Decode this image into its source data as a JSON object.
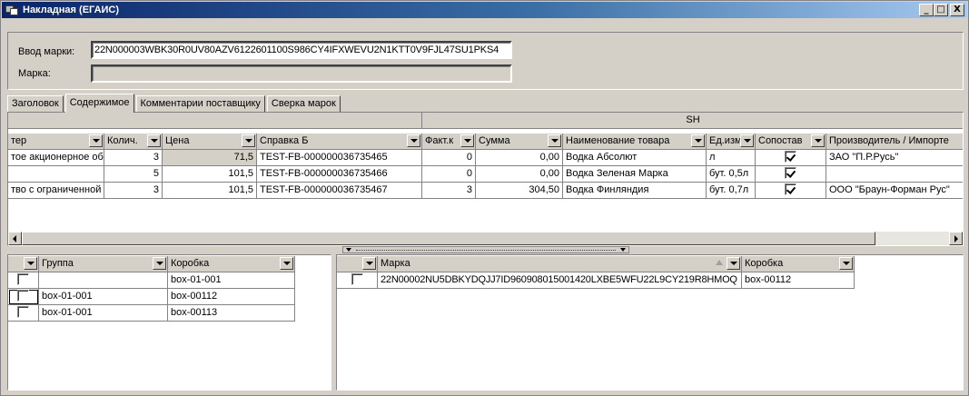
{
  "window": {
    "title": "Накладная (ЕГАИС)",
    "buttons": {
      "minimize": "_",
      "maximize": "□",
      "close": "X"
    }
  },
  "form": {
    "mark_input_label": "Ввод марки:",
    "mark_input_value": "22N000003WBK30R0UV80AZV6122601100S986CY4IFXWEVU2N1KTT0V9FJL47SU1PKS4",
    "mark_label": "Марка:",
    "mark_value": ""
  },
  "tabs": [
    {
      "label": "Заголовок",
      "active": false
    },
    {
      "label": "Содержимое",
      "active": true
    },
    {
      "label": "Комментарии поставщику",
      "active": false
    },
    {
      "label": "Сверка марок",
      "active": false
    }
  ],
  "main_grid": {
    "band_label": "SH",
    "columns": [
      "тер",
      "Колич.",
      "Цена",
      "Справка Б",
      "Факт.к",
      "Сумма",
      "Наименование товара",
      "Ед.изм",
      "Сопостав",
      "Производитель / Импорте"
    ],
    "rows": [
      {
        "producer": "тое акционерное общ",
        "qty": "3",
        "price": "71,5",
        "ref": "TEST-FB-000000036735465",
        "fact": "0",
        "sum": "0,00",
        "name": "Водка Абсолют",
        "unit": "л",
        "matched": true,
        "importer": "ЗАО \"П.Р.Русь\""
      },
      {
        "producer": "",
        "qty": "5",
        "price": "101,5",
        "ref": "TEST-FB-000000036735466",
        "fact": "0",
        "sum": "0,00",
        "name": "Водка Зеленая Марка",
        "unit": "бут. 0,5л",
        "matched": true,
        "importer": ""
      },
      {
        "producer": "тво с ограниченной",
        "qty": "3",
        "price": "101,5",
        "ref": "TEST-FB-000000036735467",
        "fact": "3",
        "sum": "304,50",
        "name": "Водка Финляндия",
        "unit": "бут. 0,7л",
        "matched": true,
        "importer": "ООО \"Браун-Форман Рус\""
      }
    ]
  },
  "group_grid": {
    "columns": [
      "",
      "Группа",
      "Коробка"
    ],
    "rows": [
      {
        "checked": false,
        "group": "",
        "box": "box-01-001"
      },
      {
        "checked": false,
        "group": "box-01-001",
        "box": "box-00112"
      },
      {
        "checked": false,
        "group": "box-01-001",
        "box": "box-00113"
      }
    ]
  },
  "mark_grid": {
    "columns": [
      "",
      "Марка",
      "Коробка"
    ],
    "rows": [
      {
        "checked": false,
        "mark": "22N00002NU5DBKYDQJJ7ID960908015001420LXBE5WFU22L9CY219R8HMOQ",
        "box": "box-00112"
      }
    ]
  }
}
